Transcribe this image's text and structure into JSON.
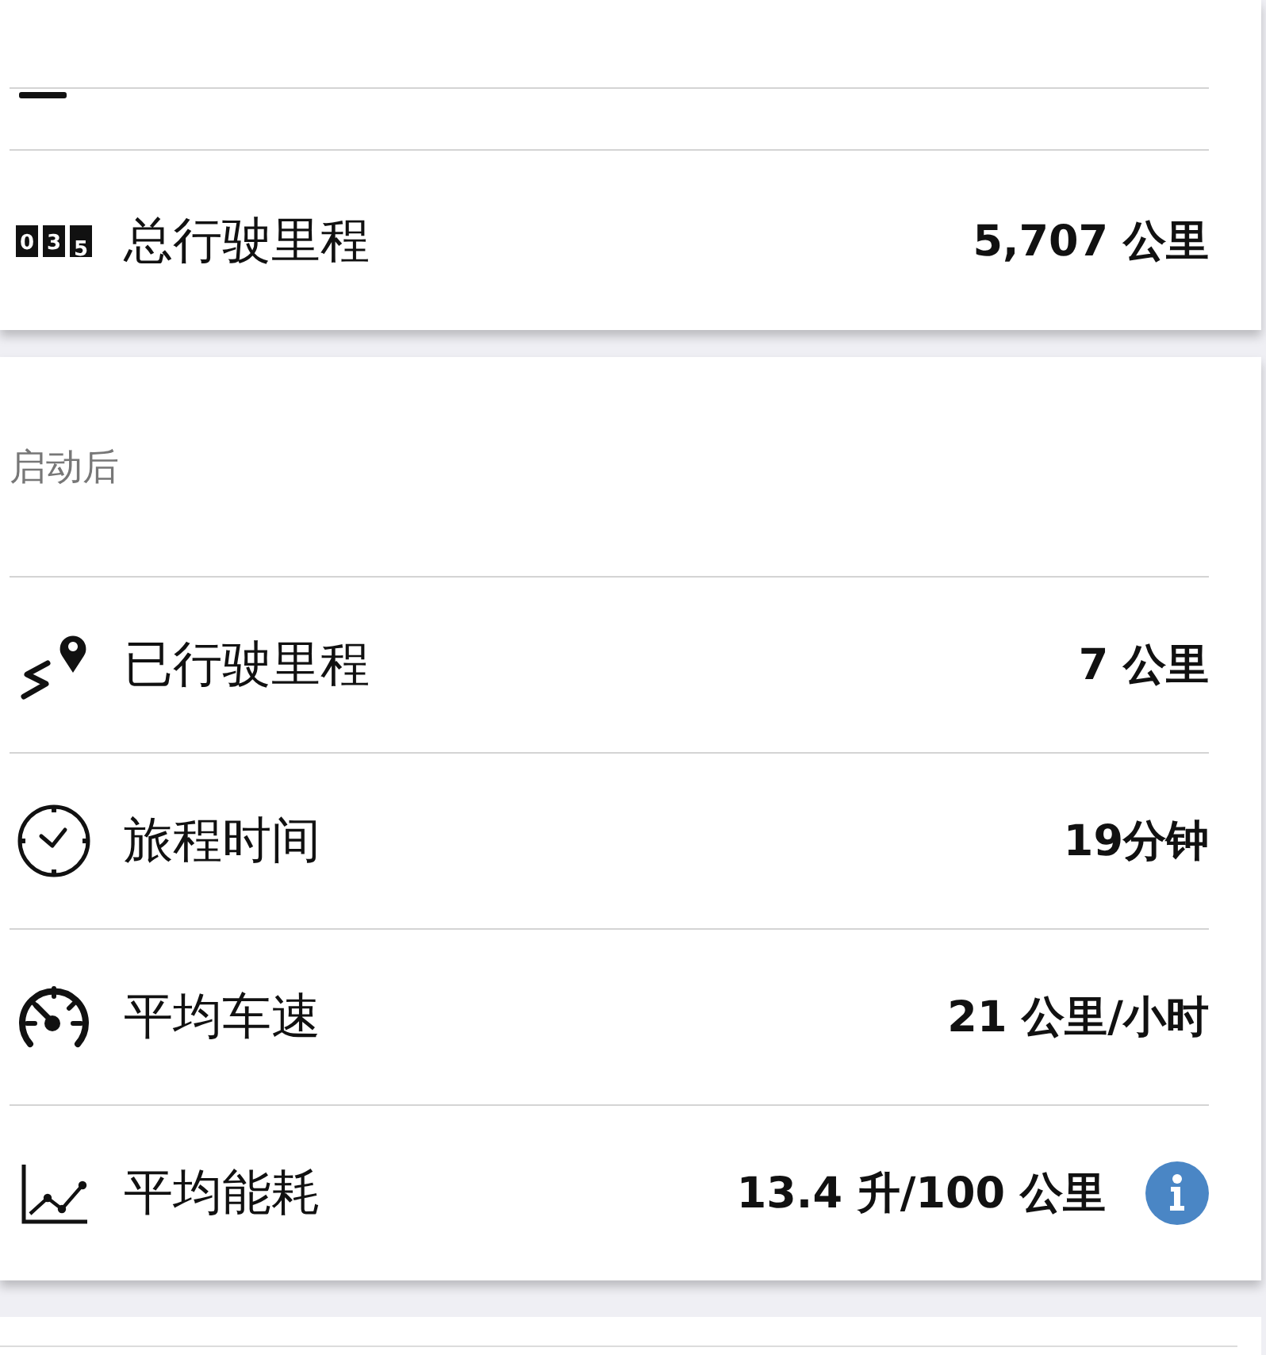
{
  "top_card": {
    "rows": [
      {
        "kind": "odometer",
        "icon_digits": [
          "0",
          "3",
          "5"
        ],
        "label": "总行驶里程",
        "value": "5,707 公里",
        "info_button": false
      }
    ]
  },
  "since_start": {
    "title": "启动后",
    "rows": [
      {
        "kind": "distance",
        "label": "已行驶里程",
        "value": "7 公里",
        "info_button": false
      },
      {
        "kind": "time",
        "label": "旅程时间",
        "value": "19分钟",
        "info_button": false
      },
      {
        "kind": "speed",
        "label": "平均车速",
        "value": "21 公里/小时",
        "info_button": false
      },
      {
        "kind": "consumption",
        "label": "平均能耗",
        "value": "13.4 升/100 公里",
        "info_button": true
      }
    ]
  }
}
